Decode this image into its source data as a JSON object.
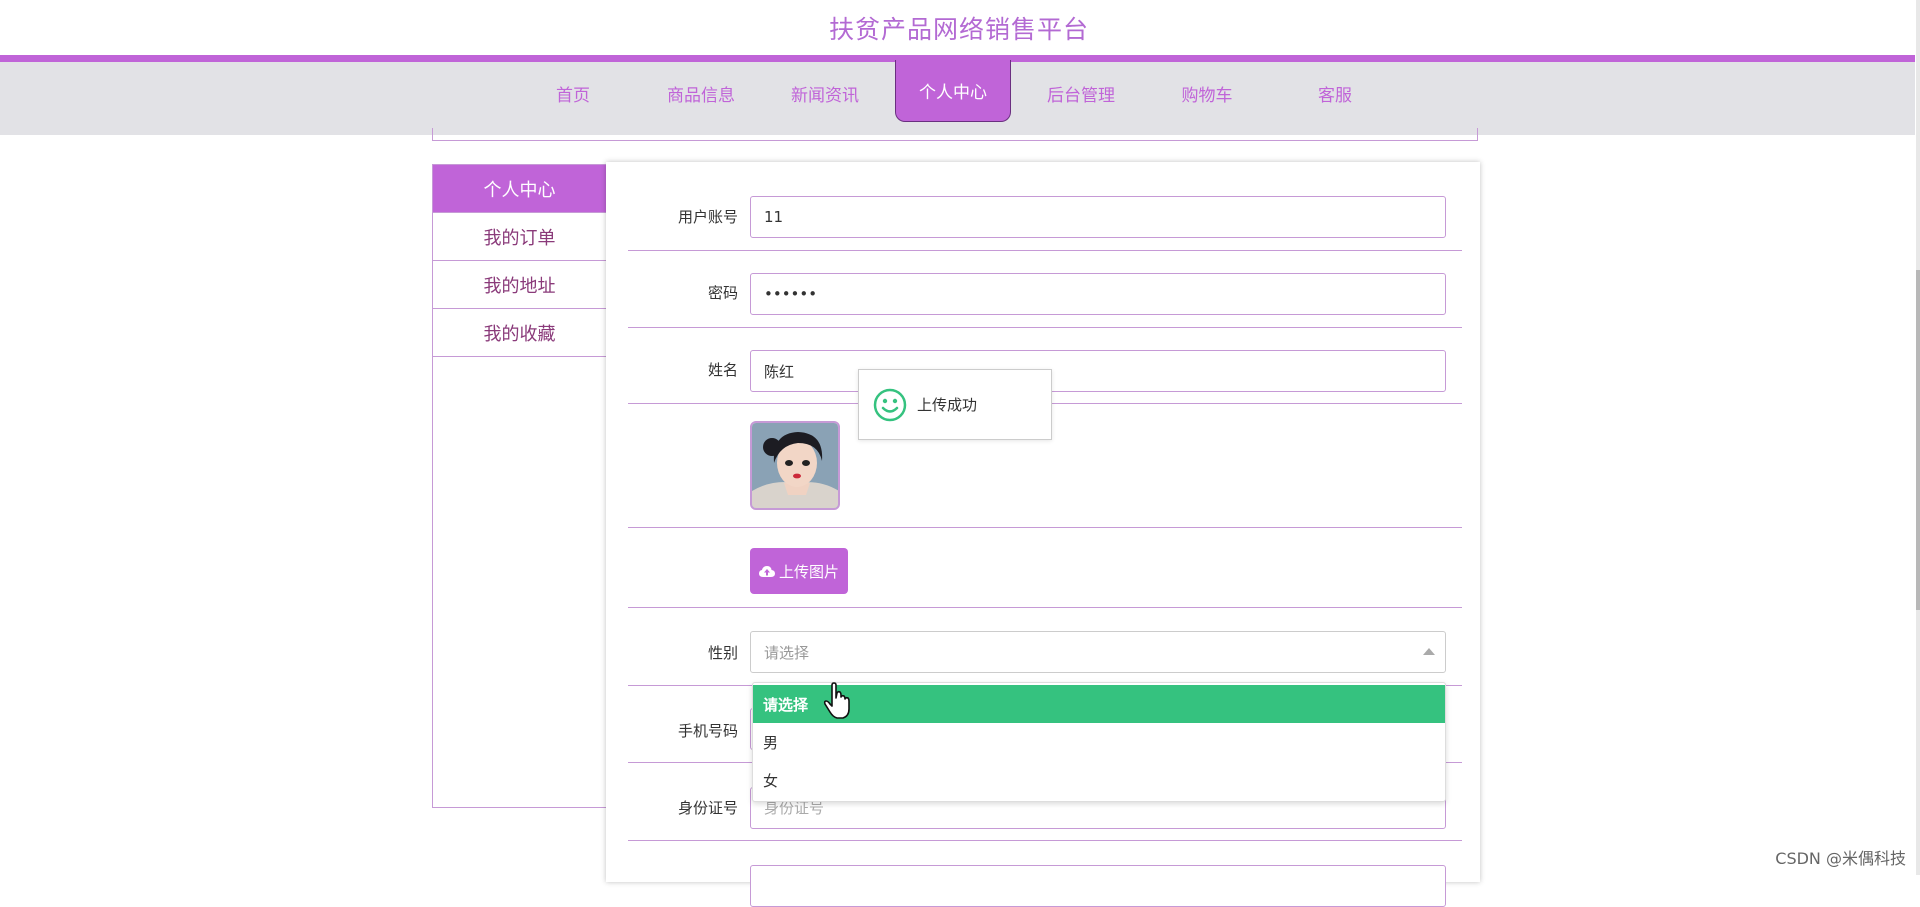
{
  "site": {
    "title": "扶贫产品网络销售平台"
  },
  "nav": {
    "items": [
      {
        "label": "首页"
      },
      {
        "label": "商品信息"
      },
      {
        "label": "新闻资讯"
      },
      {
        "label": "个人中心"
      },
      {
        "label": "后台管理"
      },
      {
        "label": "购物车"
      },
      {
        "label": "客服"
      }
    ],
    "active": "个人中心"
  },
  "sidebar": {
    "items": [
      {
        "label": "个人中心"
      },
      {
        "label": "我的订单"
      },
      {
        "label": "我的地址"
      },
      {
        "label": "我的收藏"
      }
    ]
  },
  "form": {
    "account": {
      "label": "用户账号",
      "value": "11"
    },
    "password": {
      "label": "密码",
      "value": "••••••"
    },
    "name": {
      "label": "姓名",
      "value": "陈红"
    },
    "upload_label": "上传图片",
    "gender": {
      "label": "性别",
      "placeholder": "请选择"
    },
    "phone": {
      "label": "手机号码"
    },
    "idcard": {
      "label": "身份证号",
      "placeholder": "身份证号"
    }
  },
  "dropdown": {
    "options": [
      {
        "label": "请选择"
      },
      {
        "label": "男"
      },
      {
        "label": "女"
      }
    ]
  },
  "toast": {
    "message": "上传成功"
  },
  "watermark": "CSDN @米偶科技",
  "colors": {
    "accent": "#c064d8",
    "nav_bg": "#e2e2e6",
    "success": "#35c27f"
  }
}
